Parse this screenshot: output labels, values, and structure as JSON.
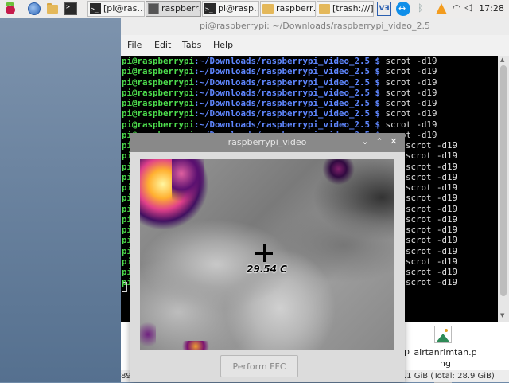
{
  "taskbar": {
    "tasks": [
      {
        "label": "[pi@ras…",
        "icon": "terminal-icon"
      },
      {
        "label": "raspberr…",
        "icon": "video-window-icon"
      },
      {
        "label": "pi@rasp…",
        "icon": "terminal-icon"
      },
      {
        "label": "raspberr…",
        "icon": "folder-icon"
      },
      {
        "label": "[trash:///]",
        "icon": "folder-icon"
      }
    ],
    "vnc_label": "VƎ",
    "clock": "17:28"
  },
  "terminal": {
    "title": "pi@raspberrypi: ~/Downloads/raspberrypi_video_2.5",
    "menu": [
      "File",
      "Edit",
      "Tabs",
      "Help"
    ],
    "prompt_user": "pi@raspberrypi",
    "prompt_path": ":~/Downloads/raspberrypi_video_2.5 $ ",
    "command": "scrot -d19",
    "partial_user": "pi",
    "partial_command": "scrot -d19"
  },
  "file_manager": {
    "file_name_line1": "airtanrimtan.p",
    "file_name_line2": "ng",
    "partial_label": "p",
    "status_left": "89",
    "status_right": ".1 GiB (Total: 28.9 GiB)"
  },
  "video_window": {
    "title": "raspberrypi_video",
    "temperature": "29.54 C",
    "ffc_button": "Perform FFC",
    "minimize_glyph": "⌄",
    "maximize_glyph": "⌃",
    "close_glyph": "✕"
  }
}
